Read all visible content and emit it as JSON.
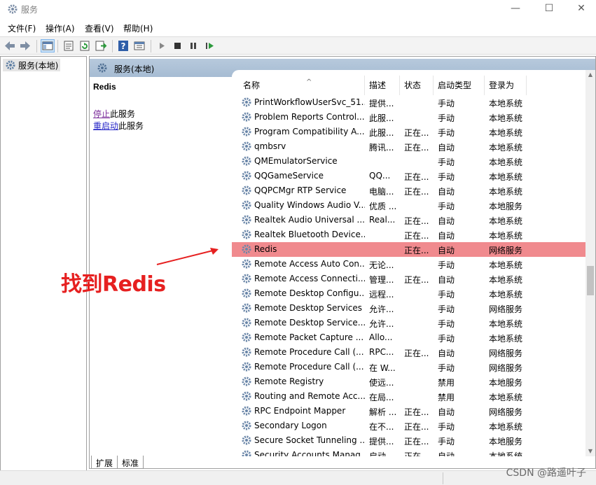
{
  "window": {
    "title": "服务",
    "minimize": "—",
    "maximize": "☐",
    "close": "✕"
  },
  "menu": [
    "文件(F)",
    "操作(A)",
    "查看(V)",
    "帮助(H)"
  ],
  "toolbar_icons": [
    "back-icon",
    "forward-icon",
    "show-hide-tree-icon",
    "properties-icon",
    "refresh-icon",
    "export-list-icon",
    "help-icon",
    "view-icon",
    "start-service-icon",
    "stop-service-icon",
    "pause-service-icon",
    "restart-service-icon"
  ],
  "tree": {
    "root": "服务(本地)"
  },
  "pane": {
    "header": "服务(本地)",
    "selected_service": "Redis",
    "actions": [
      {
        "link": "停止",
        "rest": "此服务"
      },
      {
        "link": "重启动",
        "rest": "此服务"
      }
    ]
  },
  "columns": [
    "名称",
    "描述",
    "状态",
    "启动类型",
    "登录为"
  ],
  "rows": [
    {
      "name": "PrintWorkflowUserSvc_51...",
      "desc": "提供...",
      "status": "",
      "startup": "手动",
      "logon": "本地系统"
    },
    {
      "name": "Problem Reports Control...",
      "desc": "此服...",
      "status": "",
      "startup": "手动",
      "logon": "本地系统"
    },
    {
      "name": "Program Compatibility A...",
      "desc": "此服...",
      "status": "正在...",
      "startup": "手动",
      "logon": "本地系统"
    },
    {
      "name": "qmbsrv",
      "desc": "腾讯...",
      "status": "正在...",
      "startup": "自动",
      "logon": "本地系统"
    },
    {
      "name": "QMEmulatorService",
      "desc": "",
      "status": "",
      "startup": "手动",
      "logon": "本地系统"
    },
    {
      "name": "QQGameService",
      "desc": "QQ...",
      "status": "正在...",
      "startup": "手动",
      "logon": "本地系统"
    },
    {
      "name": "QQPCMgr RTP Service",
      "desc": "电脑...",
      "status": "正在...",
      "startup": "自动",
      "logon": "本地系统"
    },
    {
      "name": "Quality Windows Audio V...",
      "desc": "优质 ...",
      "status": "",
      "startup": "手动",
      "logon": "本地服务"
    },
    {
      "name": "Realtek Audio Universal ...",
      "desc": "Real...",
      "status": "正在...",
      "startup": "自动",
      "logon": "本地系统"
    },
    {
      "name": "Realtek Bluetooth Device...",
      "desc": "",
      "status": "正在...",
      "startup": "自动",
      "logon": "本地系统"
    },
    {
      "name": "Redis",
      "desc": "",
      "status": "正在...",
      "startup": "自动",
      "logon": "网络服务",
      "highlight": true
    },
    {
      "name": "Remote Access Auto Con...",
      "desc": "无论...",
      "status": "",
      "startup": "手动",
      "logon": "本地系统"
    },
    {
      "name": "Remote Access Connecti...",
      "desc": "管理...",
      "status": "正在...",
      "startup": "自动",
      "logon": "本地系统"
    },
    {
      "name": "Remote Desktop Configu...",
      "desc": "远程...",
      "status": "",
      "startup": "手动",
      "logon": "本地系统"
    },
    {
      "name": "Remote Desktop Services",
      "desc": "允许...",
      "status": "",
      "startup": "手动",
      "logon": "网络服务"
    },
    {
      "name": "Remote Desktop Service...",
      "desc": "允许...",
      "status": "",
      "startup": "手动",
      "logon": "本地系统"
    },
    {
      "name": "Remote Packet Capture ...",
      "desc": "Allo...",
      "status": "",
      "startup": "手动",
      "logon": "本地系统"
    },
    {
      "name": "Remote Procedure Call (...",
      "desc": "RPC...",
      "status": "正在...",
      "startup": "自动",
      "logon": "网络服务"
    },
    {
      "name": "Remote Procedure Call (...",
      "desc": "在 W...",
      "status": "",
      "startup": "手动",
      "logon": "网络服务"
    },
    {
      "name": "Remote Registry",
      "desc": "使远...",
      "status": "",
      "startup": "禁用",
      "logon": "本地服务"
    },
    {
      "name": "Routing and Remote Acc...",
      "desc": "在局...",
      "status": "",
      "startup": "禁用",
      "logon": "本地系统"
    },
    {
      "name": "RPC Endpoint Mapper",
      "desc": "解析 ...",
      "status": "正在...",
      "startup": "自动",
      "logon": "网络服务"
    },
    {
      "name": "Secondary Logon",
      "desc": "在不...",
      "status": "正在...",
      "startup": "手动",
      "logon": "本地系统"
    },
    {
      "name": "Secure Socket Tunneling ...",
      "desc": "提供...",
      "status": "正在...",
      "startup": "手动",
      "logon": "本地服务"
    },
    {
      "name": "Security Accounts Manag...",
      "desc": "启动...",
      "status": "正在...",
      "startup": "自动",
      "logon": "本地系统"
    }
  ],
  "tabs": [
    "扩展",
    "标准"
  ],
  "annotation": "找到Redis",
  "watermark": "CSDN @路遥叶子",
  "colors": {
    "highlight": "#f08a8e",
    "annotation": "#e62020",
    "pane_header": "#b7c9dc"
  }
}
